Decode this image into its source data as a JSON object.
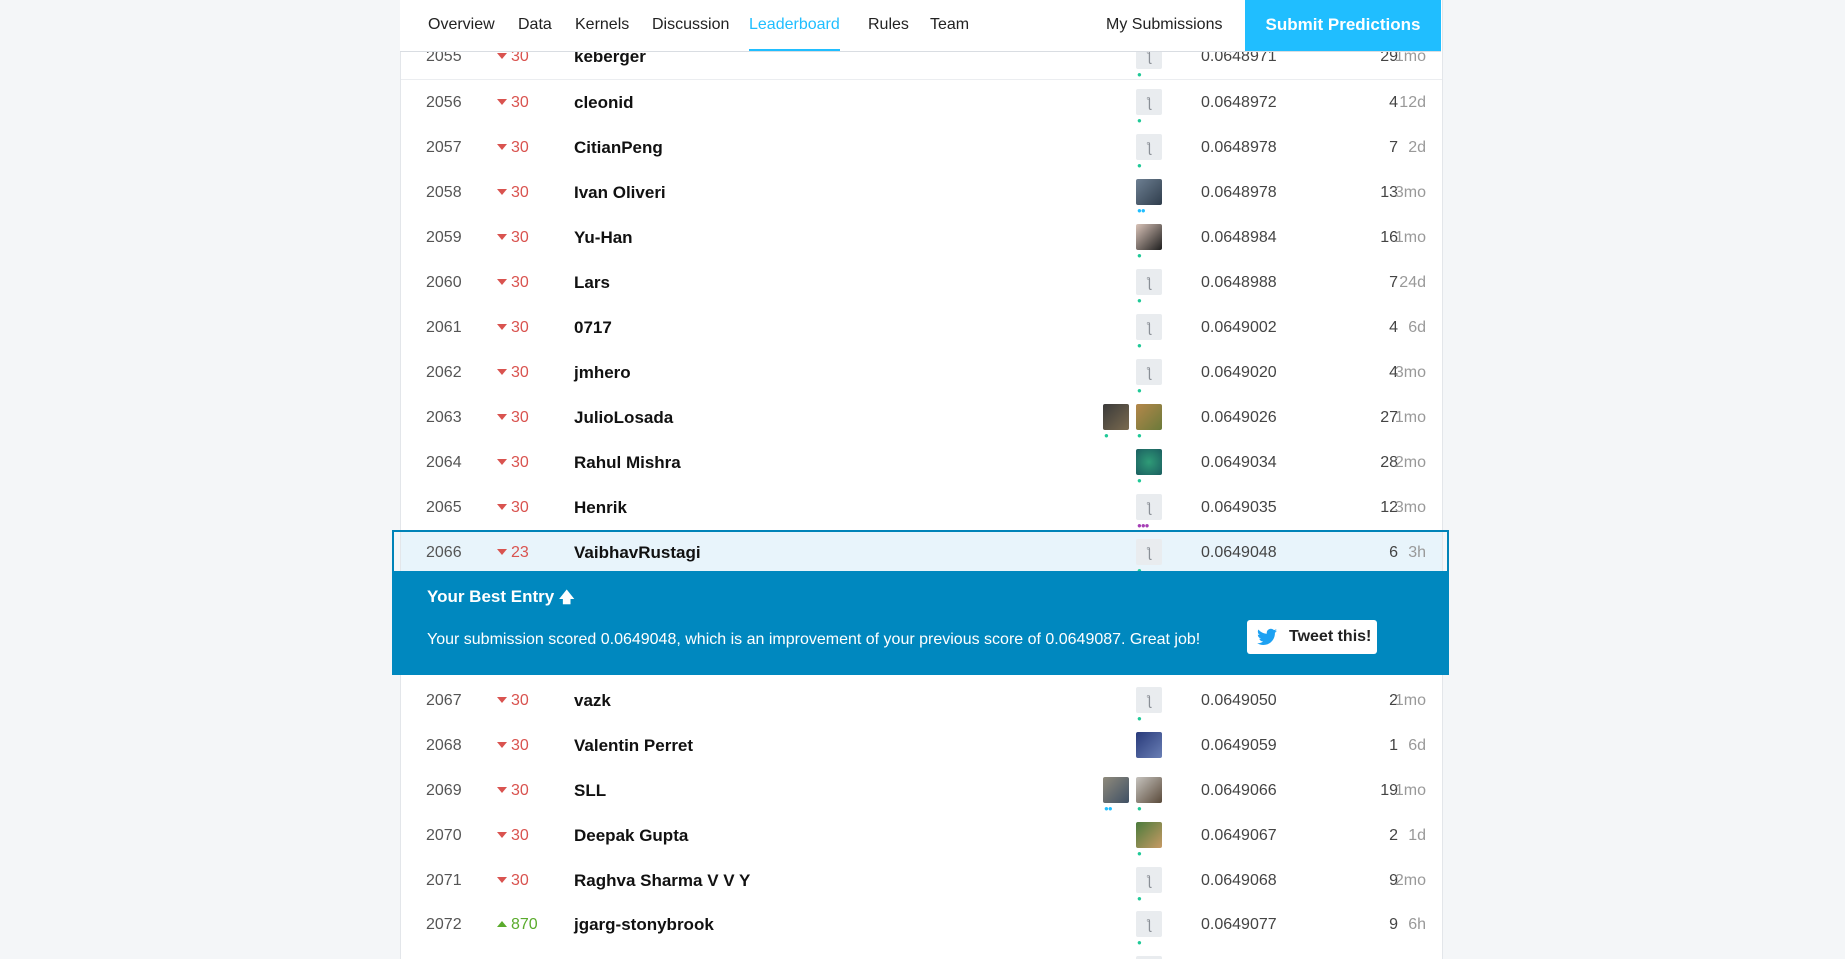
{
  "nav": {
    "tabs": [
      {
        "label": "Overview"
      },
      {
        "label": "Data"
      },
      {
        "label": "Kernels"
      },
      {
        "label": "Discussion"
      },
      {
        "label": "Leaderboard"
      },
      {
        "label": "Rules"
      },
      {
        "label": "Team"
      }
    ],
    "active_tab": "Leaderboard",
    "my_submissions": "My Submissions",
    "submit_predictions": "Submit Predictions"
  },
  "leaderboard": {
    "rows_before": [
      {
        "rank": "2055",
        "delta": "30",
        "dir": "down",
        "name": "keberger",
        "avatars": [
          "default"
        ],
        "score": "0.0648971",
        "entries": "29",
        "last": "1mo"
      },
      {
        "rank": "2056",
        "delta": "30",
        "dir": "down",
        "name": "cleonid",
        "avatars": [
          "default"
        ],
        "score": "0.0648972",
        "entries": "4",
        "last": "12d"
      },
      {
        "rank": "2057",
        "delta": "30",
        "dir": "down",
        "name": "CitianPeng",
        "avatars": [
          "default"
        ],
        "score": "0.0648978",
        "entries": "7",
        "last": "2d"
      },
      {
        "rank": "2058",
        "delta": "30",
        "dir": "down",
        "name": "Ivan Oliveri",
        "avatars": [
          "photo"
        ],
        "score": "0.0648978",
        "entries": "13",
        "last": "3mo"
      },
      {
        "rank": "2059",
        "delta": "30",
        "dir": "down",
        "name": "Yu-Han",
        "avatars": [
          "photo"
        ],
        "score": "0.0648984",
        "entries": "16",
        "last": "1mo"
      },
      {
        "rank": "2060",
        "delta": "30",
        "dir": "down",
        "name": "Lars",
        "avatars": [
          "default"
        ],
        "score": "0.0648988",
        "entries": "7",
        "last": "24d"
      },
      {
        "rank": "2061",
        "delta": "30",
        "dir": "down",
        "name": "0717",
        "avatars": [
          "default"
        ],
        "score": "0.0649002",
        "entries": "4",
        "last": "6d"
      },
      {
        "rank": "2062",
        "delta": "30",
        "dir": "down",
        "name": "jmhero",
        "avatars": [
          "default"
        ],
        "score": "0.0649020",
        "entries": "4",
        "last": "3mo"
      },
      {
        "rank": "2063",
        "delta": "30",
        "dir": "down",
        "name": "JulioLosada",
        "avatars": [
          "photo",
          "photo"
        ],
        "score": "0.0649026",
        "entries": "27",
        "last": "1mo"
      },
      {
        "rank": "2064",
        "delta": "30",
        "dir": "down",
        "name": "Rahul Mishra",
        "avatars": [
          "photo"
        ],
        "score": "0.0649034",
        "entries": "28",
        "last": "2mo"
      },
      {
        "rank": "2065",
        "delta": "30",
        "dir": "down",
        "name": "Henrik",
        "avatars": [
          "default"
        ],
        "score": "0.0649035",
        "entries": "12",
        "last": "3mo"
      }
    ],
    "my_row": {
      "rank": "2066",
      "delta": "23",
      "dir": "down",
      "name": "VaibhavRustagi",
      "avatars": [
        "default"
      ],
      "score": "0.0649048",
      "entries": "6",
      "last": "3h"
    },
    "rows_after": [
      {
        "rank": "2067",
        "delta": "30",
        "dir": "down",
        "name": "vazk",
        "avatars": [
          "default"
        ],
        "score": "0.0649050",
        "entries": "2",
        "last": "1mo"
      },
      {
        "rank": "2068",
        "delta": "30",
        "dir": "down",
        "name": "Valentin Perret",
        "avatars": [
          "photo"
        ],
        "score": "0.0649059",
        "entries": "1",
        "last": "6d"
      },
      {
        "rank": "2069",
        "delta": "30",
        "dir": "down",
        "name": "SLL",
        "avatars": [
          "photo",
          "photo"
        ],
        "score": "0.0649066",
        "entries": "19",
        "last": "1mo"
      },
      {
        "rank": "2070",
        "delta": "30",
        "dir": "down",
        "name": "Deepak Gupta",
        "avatars": [
          "photo"
        ],
        "score": "0.0649067",
        "entries": "2",
        "last": "1d"
      },
      {
        "rank": "2071",
        "delta": "30",
        "dir": "down",
        "name": "Raghva Sharma V V Y",
        "avatars": [
          "default"
        ],
        "score": "0.0649068",
        "entries": "9",
        "last": "2mo"
      },
      {
        "rank": "2072",
        "delta": "870",
        "dir": "up",
        "name": "jgarg-stonybrook",
        "avatars": [
          "default"
        ],
        "score": "0.0649077",
        "entries": "9",
        "last": "6h"
      }
    ]
  },
  "best_entry": {
    "title": "Your Best Entry",
    "arrow": "🡅",
    "message": "Your submission scored 0.0649048, which is an improvement of your previous score of 0.0649087. Great job!",
    "tweet_label": "Tweet this!"
  },
  "colors": {
    "accent": "#20beff",
    "banner": "#0088bf",
    "down": "#d9534f",
    "up": "#5aab2c"
  }
}
